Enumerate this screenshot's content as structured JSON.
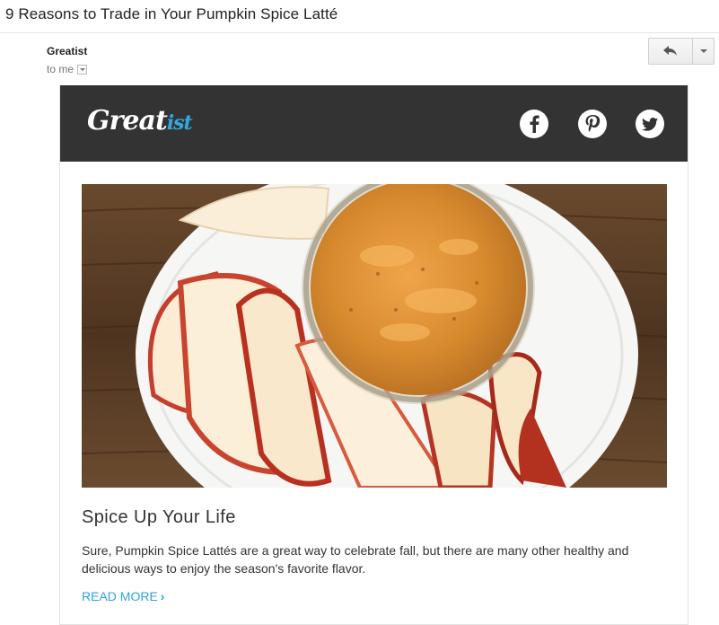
{
  "email": {
    "subject": "9 Reasons to Trade in Your Pumpkin Spice Latté",
    "sender": "Greatist",
    "recipient": "to me"
  },
  "toolbar": {
    "reply_icon": "reply-icon",
    "more_icon": "chevron-down-icon"
  },
  "newsletter": {
    "logo_main": "Great",
    "logo_accent": "ist",
    "social": [
      "facebook-icon",
      "pinterest-icon",
      "twitter-icon"
    ],
    "header_color": "#333333",
    "accent_color": "#2fa3dc",
    "article": {
      "title": "Spice Up Your Life",
      "body": "Sure, Pumpkin Spice Lattés are a great way to celebrate fall, but there are many other healthy and delicious ways to enjoy the season's favorite flavor.",
      "cta": "READ MORE",
      "cta_icon": "›"
    }
  }
}
